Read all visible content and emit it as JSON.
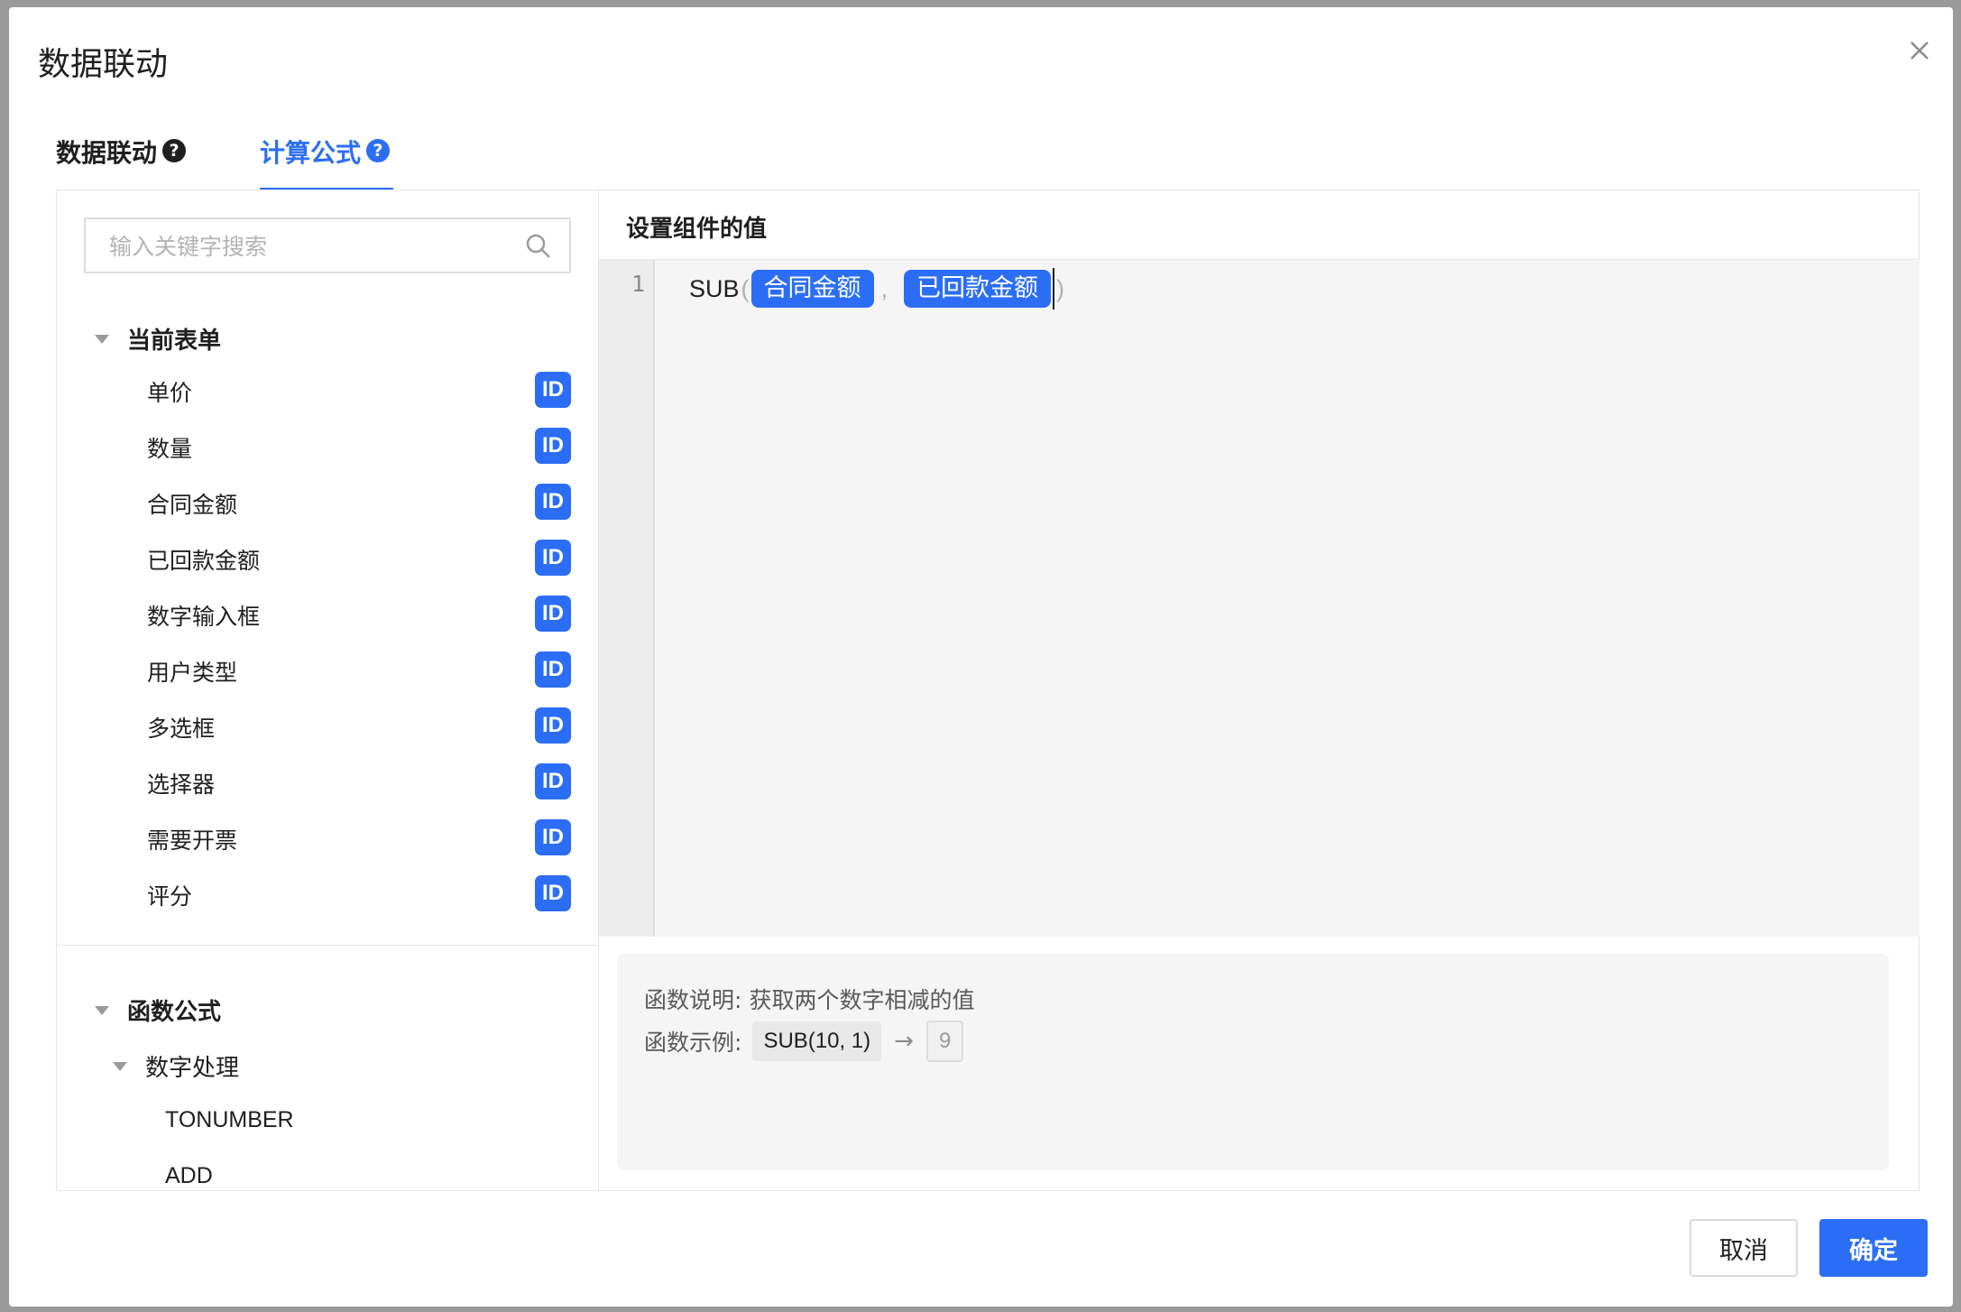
{
  "dialog": {
    "title": "数据联动",
    "cancel_label": "取消",
    "ok_label": "确定"
  },
  "tabs": [
    {
      "label": "数据联动",
      "active": false
    },
    {
      "label": "计算公式",
      "active": true
    }
  ],
  "help_glyph": "?",
  "search": {
    "placeholder": "输入关键字搜索",
    "value": ""
  },
  "current_form": {
    "label": "当前表单",
    "badge": "ID",
    "fields": [
      "单价",
      "数量",
      "合同金额",
      "已回款金额",
      "数字输入框",
      "用户类型",
      "多选框",
      "选择器",
      "需要开票",
      "评分"
    ]
  },
  "functions": {
    "label": "函数公式",
    "subgroup": {
      "label": "数字处理",
      "items": [
        "TONUMBER",
        "ADD"
      ]
    }
  },
  "editor": {
    "title": "设置组件的值",
    "line_number": "1",
    "function_name": "SUB",
    "open_paren": "(",
    "close_paren": ")",
    "comma": ",",
    "args": [
      "合同金额",
      "已回款金额"
    ]
  },
  "description": {
    "explain_label": "函数说明:",
    "explain_text": "获取两个数字相减的值",
    "example_label": "函数示例:",
    "example_code": "SUB(10, 1)",
    "example_result": "9"
  },
  "colors": {
    "accent": "#2b6ef5",
    "text": "#1f1f1f",
    "muted": "#595959"
  }
}
